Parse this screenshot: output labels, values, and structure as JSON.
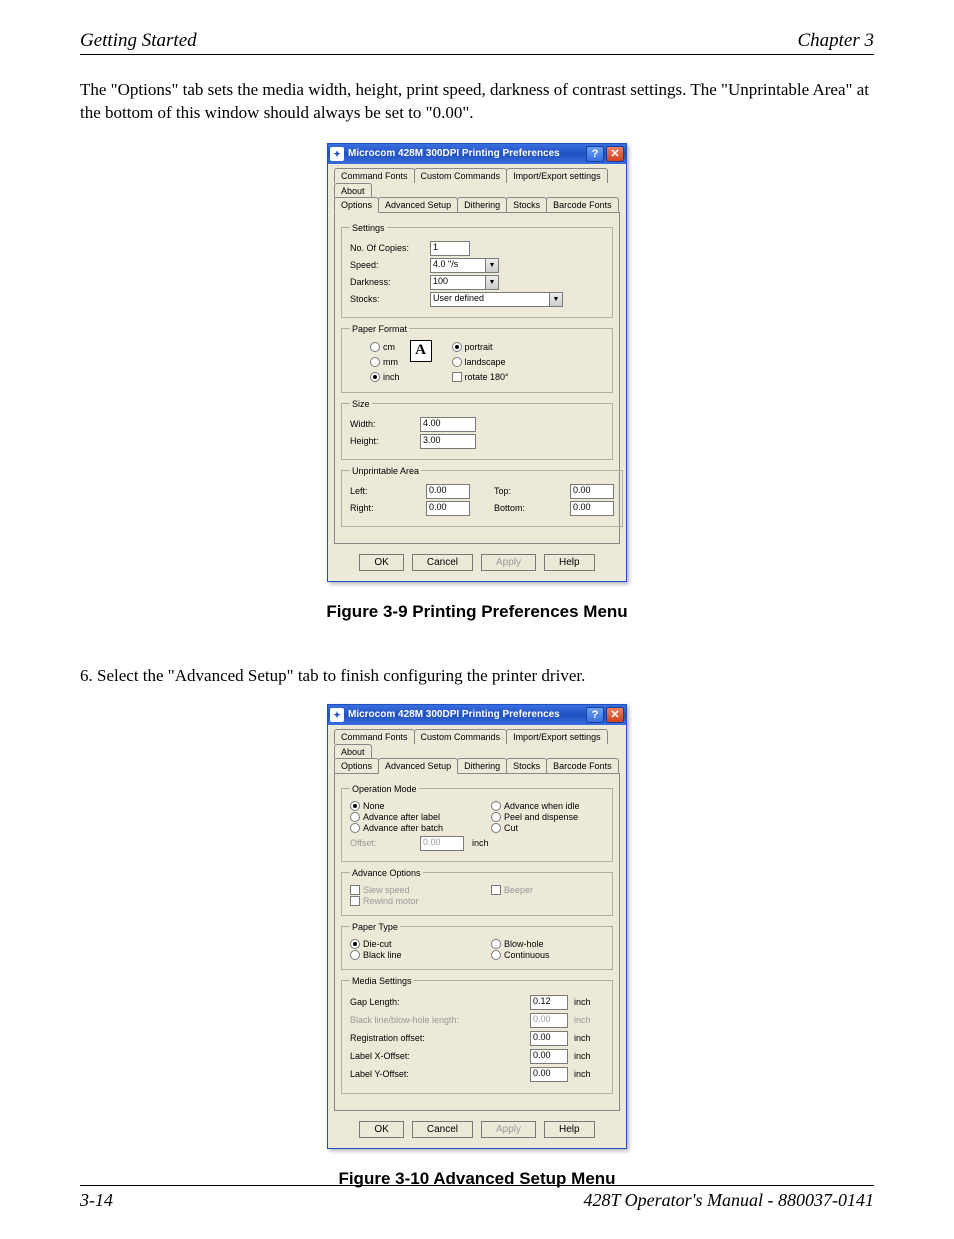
{
  "header": {
    "left": "Getting Started",
    "right": "Chapter 3"
  },
  "body": {
    "p1": "The \"Options\" tab sets the media width, height, print speed, darkness of contrast settings. The \"Unprintable Area\" at the bottom of this window should always be set to \"0.00\".",
    "step6": "6.  Select the \"Advanced Setup\" tab to finish configuring the printer driver."
  },
  "captions": {
    "fig9": "Figure 3-9    Printing Preferences Menu",
    "fig10": "Figure 3-10  Advanced Setup Menu"
  },
  "footer": {
    "left": "3-14",
    "right": "428T Operator's Manual - 880037-0141"
  },
  "dlg": {
    "title": "Microcom 428M 300DPI Printing Preferences",
    "tabs_row1": [
      "Command Fonts",
      "Custom Commands",
      "Import/Export settings",
      "About"
    ],
    "tabs_row2": [
      "Options",
      "Advanced Setup",
      "Dithering",
      "Stocks",
      "Barcode Fonts"
    ],
    "buttons": {
      "ok": "OK",
      "cancel": "Cancel",
      "apply": "Apply",
      "help": "Help"
    }
  },
  "opt": {
    "settings": {
      "legend": "Settings",
      "copies_lbl": "No. Of Copies:",
      "copies": "1",
      "speed_lbl": "Speed:",
      "speed": "4.0 \"/s",
      "darkness_lbl": "Darkness:",
      "darkness": "100",
      "stocks_lbl": "Stocks:",
      "stocks": "User defined"
    },
    "paper": {
      "legend": "Paper Format",
      "units": {
        "cm": "cm",
        "mm": "mm",
        "inch": "inch"
      },
      "orient": {
        "portrait": "portrait",
        "landscape": "landscape",
        "rotate": "rotate 180°"
      }
    },
    "size": {
      "legend": "Size",
      "width_lbl": "Width:",
      "width": "4.00",
      "height_lbl": "Height:",
      "height": "3.00"
    },
    "unprint": {
      "legend": "Unprintable Area",
      "left_lbl": "Left:",
      "left": "0.00",
      "right_lbl": "Right:",
      "right": "0.00",
      "top_lbl": "Top:",
      "top": "0.00",
      "bottom_lbl": "Bottom:",
      "bottom": "0.00"
    }
  },
  "adv": {
    "opmode": {
      "legend": "Operation Mode",
      "none": "None",
      "aal": "Advance after label",
      "aab": "Advance after batch",
      "awi": "Advance when idle",
      "pad": "Peel and dispense",
      "cut": "Cut",
      "offset_lbl": "Offset:",
      "offset": "0.00",
      "unit": "inch"
    },
    "advopt": {
      "legend": "Advance Options",
      "slow": "Slew speed",
      "rewind": "Rewind motor",
      "beeper": "Beeper"
    },
    "paper": {
      "legend": "Paper Type",
      "diecut": "Die-cut",
      "black": "Black line",
      "blow": "Blow-hole",
      "cont": "Continuous"
    },
    "media": {
      "legend": "Media Settings",
      "gap_lbl": "Gap Length:",
      "gap": "0.12",
      "blk_lbl": "Black line/blow-hole length:",
      "blk": "0.00",
      "reg_lbl": "Registration offset:",
      "reg": "0.00",
      "lx_lbl": "Label X-Offset:",
      "lx": "0.00",
      "ly_lbl": "Label Y-Offset:",
      "ly": "0.00",
      "unit": "inch"
    }
  }
}
